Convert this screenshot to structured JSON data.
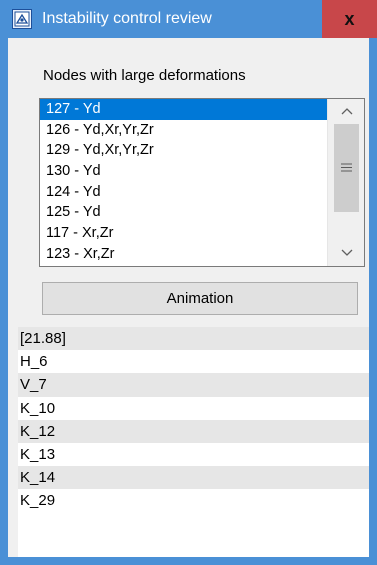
{
  "window": {
    "title": "Instability control review",
    "close_label": "x",
    "app_icon": "software-app-icon"
  },
  "nodes_group": {
    "label": "Nodes with large deformations",
    "items": [
      {
        "label": "127 - Yd",
        "selected": true
      },
      {
        "label": "126 - Yd,Xr,Yr,Zr",
        "selected": false
      },
      {
        "label": "129 - Yd,Xr,Yr,Zr",
        "selected": false
      },
      {
        "label": "130 - Yd",
        "selected": false
      },
      {
        "label": "124 - Yd",
        "selected": false
      },
      {
        "label": "125 - Yd",
        "selected": false
      },
      {
        "label": "117 - Xr,Zr",
        "selected": false
      },
      {
        "label": "123 - Xr,Zr",
        "selected": false
      }
    ],
    "scroll_up_icon": "chevron-up-icon",
    "scroll_down_icon": "chevron-down-icon"
  },
  "animation_button": {
    "label": "Animation"
  },
  "results": {
    "rows": [
      "[21.88]",
      "H_6",
      "V_7",
      "K_10",
      "K_12",
      "K_13",
      "K_14",
      "K_29"
    ]
  },
  "colors": {
    "title_bar": "#4a90d6",
    "close_button": "#c8474a",
    "selection": "#0078d7"
  }
}
